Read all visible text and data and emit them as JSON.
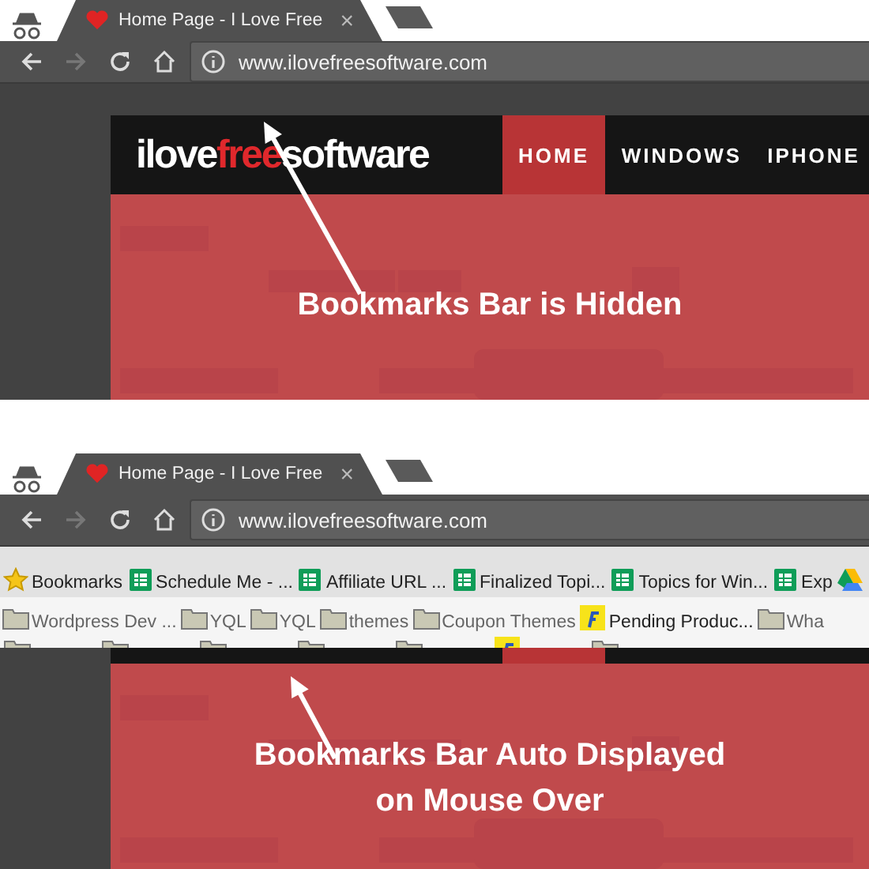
{
  "panels": [
    {
      "tab": {
        "title": "Home Page - I Love Free",
        "close": "×"
      },
      "toolbar": {
        "forward_disabled": true,
        "url": "www.ilovefreesoftware.com"
      },
      "site": {
        "logo": [
          {
            "text": "ilove",
            "highlight": false
          },
          {
            "text": "free",
            "highlight": true
          },
          {
            "text": "software",
            "highlight": false
          }
        ],
        "nav": [
          {
            "label": "HOME",
            "selected": true
          },
          {
            "label": "WINDOWS",
            "selected": false
          },
          {
            "label": "IPHONE",
            "selected": false
          }
        ]
      },
      "caption": [
        "Bookmarks Bar is Hidden"
      ]
    },
    {
      "tab": {
        "title": "Home Page - I Love Free",
        "close": "×"
      },
      "toolbar": {
        "forward_disabled": true,
        "url": "www.ilovefreesoftware.com"
      },
      "bookmarks_bar": {
        "items": [
          {
            "kind": "star",
            "label": "Bookmarks"
          },
          {
            "kind": "sheet",
            "label": "Schedule Me - ..."
          },
          {
            "kind": "sheet",
            "label": "Affiliate URL ..."
          },
          {
            "kind": "sheet",
            "label": "Finalized Topi..."
          },
          {
            "kind": "sheet",
            "label": "Topics for Win..."
          },
          {
            "kind": "sheet",
            "label": "Exp"
          },
          {
            "kind": "drive"
          }
        ],
        "folders": [
          {
            "kind": "folder",
            "label": "Wordpress Dev ..."
          },
          {
            "kind": "folder",
            "label": "YQL"
          },
          {
            "kind": "folder",
            "label": "YQL"
          },
          {
            "kind": "folder",
            "label": "themes"
          },
          {
            "kind": "folder",
            "label": "Coupon Themes"
          },
          {
            "kind": "flipkart",
            "label": "Pending Produc..."
          },
          {
            "kind": "folder",
            "label": "Wha"
          }
        ]
      },
      "site": {
        "nav": [
          {
            "selected": true
          },
          {
            "selected": false
          },
          {
            "selected": false
          }
        ]
      },
      "caption": [
        "Bookmarks Bar Auto Displayed",
        "on Mouse Over"
      ]
    }
  ]
}
